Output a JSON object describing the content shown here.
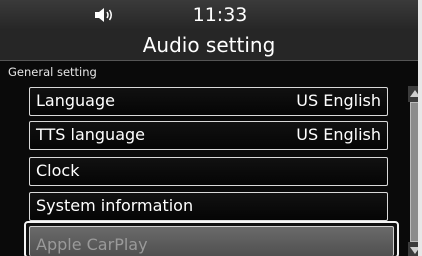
{
  "status_bar": {
    "time": "11:33",
    "volume_icon": "speaker-volume-icon"
  },
  "header": {
    "title": "Audio setting"
  },
  "section": {
    "label": "General setting"
  },
  "menu": {
    "items": [
      {
        "label": "Language",
        "value": "US English"
      },
      {
        "label": "TTS language",
        "value": "US English"
      },
      {
        "label": "Clock",
        "value": ""
      },
      {
        "label": "System information",
        "value": ""
      },
      {
        "label": "Apple CarPlay",
        "value": ""
      }
    ],
    "selected_index": 4
  },
  "scrollbar": {
    "up_icon": "scroll-up-arrow-icon",
    "down_icon": "scroll-down-arrow-icon"
  },
  "colors": {
    "background": "#0a0a0a",
    "header": "#262626",
    "border": "#d9d9d9",
    "selected": "#5e5e5e"
  }
}
